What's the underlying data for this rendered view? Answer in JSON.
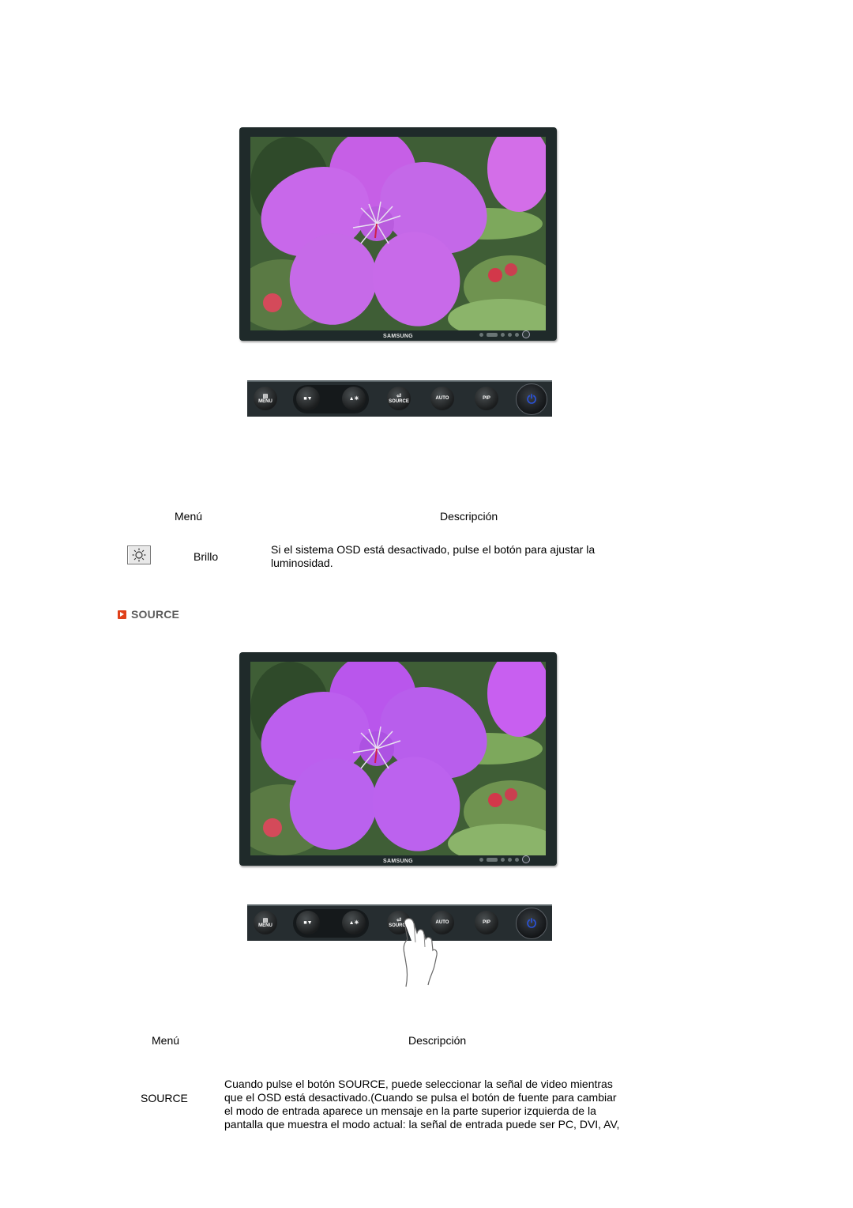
{
  "section1": {
    "monitor": {
      "brand": "SAMSUNG",
      "image": "pink-flower-photo"
    },
    "panel": {
      "buttons": [
        {
          "id": "menu",
          "icon": "menu-icon",
          "label": "MENU"
        },
        {
          "id": "magic-down",
          "icon": "magicbright-down-icon",
          "label": ""
        },
        {
          "id": "up-brightness",
          "icon": "up-brightness-icon",
          "label": ""
        },
        {
          "id": "source",
          "icon": "source-icon",
          "label": "SOURCE"
        },
        {
          "id": "auto",
          "icon": "",
          "label": "AUTO"
        },
        {
          "id": "pip",
          "icon": "",
          "label": "PIP"
        },
        {
          "id": "power",
          "icon": "power-icon",
          "label": ""
        }
      ]
    },
    "table": {
      "header_menu": "Menú",
      "header_description": "Descripción",
      "row": {
        "icon": "sun-icon",
        "menu": "Brillo",
        "description": "Si el sistema OSD está desactivado, pulse el botón para ajustar la luminosidad."
      }
    }
  },
  "section2": {
    "title": "SOURCE",
    "title_color": "#5c5c5c",
    "bullet_color": "#e0401a",
    "monitor": {
      "brand": "SAMSUNG",
      "image": "pink-flower-photo"
    },
    "panel": {
      "buttons": [
        {
          "id": "menu",
          "icon": "menu-icon",
          "label": "MENU"
        },
        {
          "id": "magic-down",
          "icon": "magicbright-down-icon",
          "label": ""
        },
        {
          "id": "up-brightness",
          "icon": "up-brightness-icon",
          "label": ""
        },
        {
          "id": "source",
          "icon": "source-icon",
          "label": "SOURCE"
        },
        {
          "id": "auto",
          "icon": "",
          "label": "AUTO"
        },
        {
          "id": "pip",
          "icon": "",
          "label": "PIP"
        },
        {
          "id": "power",
          "icon": "power-icon",
          "label": ""
        }
      ],
      "pointer": "hand-pressing-source"
    },
    "table": {
      "header_menu": "Menú",
      "header_description": "Descripción",
      "row": {
        "menu": "SOURCE",
        "description_lines": [
          "Cuando pulse el botón SOURCE, puede seleccionar la señal de video mientras",
          "que el OSD está desactivado.(Cuando se pulsa el botón de fuente para cambiar",
          "el modo de entrada aparece un mensaje en la parte superior izquierda de la",
          "pantalla que muestra el modo actual: la señal de entrada puede ser PC, DVI, AV,"
        ]
      }
    }
  }
}
